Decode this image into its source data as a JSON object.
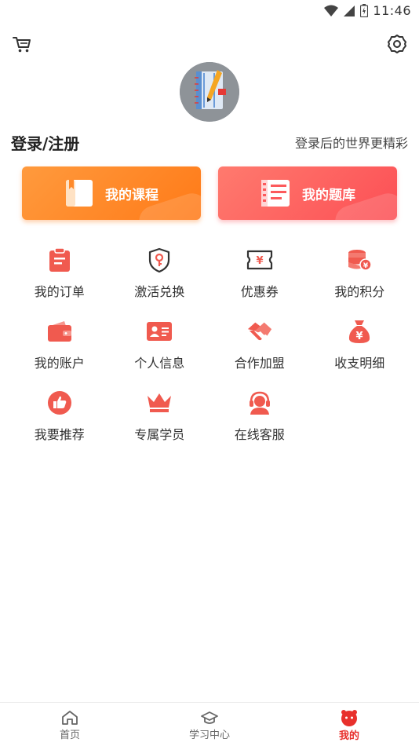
{
  "status_bar": {
    "time": "11:46"
  },
  "header": {
    "cart_icon": "cart-icon",
    "settings_icon": "gear-icon"
  },
  "profile": {
    "login_label": "登录/注册",
    "login_hint": "登录后的世界更精彩"
  },
  "big_buttons": [
    {
      "label": "我的课程",
      "icon": "book-icon",
      "color": "#ff8a2a"
    },
    {
      "label": "我的题库",
      "icon": "question-bank-icon",
      "color": "#fc5a5c"
    }
  ],
  "menu": {
    "items": [
      {
        "label": "我的订单",
        "icon": "clipboard-icon"
      },
      {
        "label": "激活兑换",
        "icon": "shield-key-icon"
      },
      {
        "label": "优惠券",
        "icon": "coupon-icon"
      },
      {
        "label": "我的积分",
        "icon": "coins-icon"
      },
      {
        "label": "我的账户",
        "icon": "wallet-icon"
      },
      {
        "label": "个人信息",
        "icon": "id-card-icon"
      },
      {
        "label": "合作加盟",
        "icon": "handshake-icon"
      },
      {
        "label": "收支明细",
        "icon": "money-bag-icon"
      },
      {
        "label": "我要推荐",
        "icon": "thumbs-up-icon"
      },
      {
        "label": "专属学员",
        "icon": "crown-icon"
      },
      {
        "label": "在线客服",
        "icon": "customer-service-icon"
      }
    ]
  },
  "bottom_nav": {
    "items": [
      {
        "label": "首页",
        "icon": "home-icon"
      },
      {
        "label": "学习中心",
        "icon": "graduation-cap-icon"
      },
      {
        "label": "我的",
        "icon": "mine-face-icon"
      }
    ],
    "active": "我的"
  },
  "colors": {
    "accent": "#f05a4f",
    "active_nav": "#e8302c"
  }
}
